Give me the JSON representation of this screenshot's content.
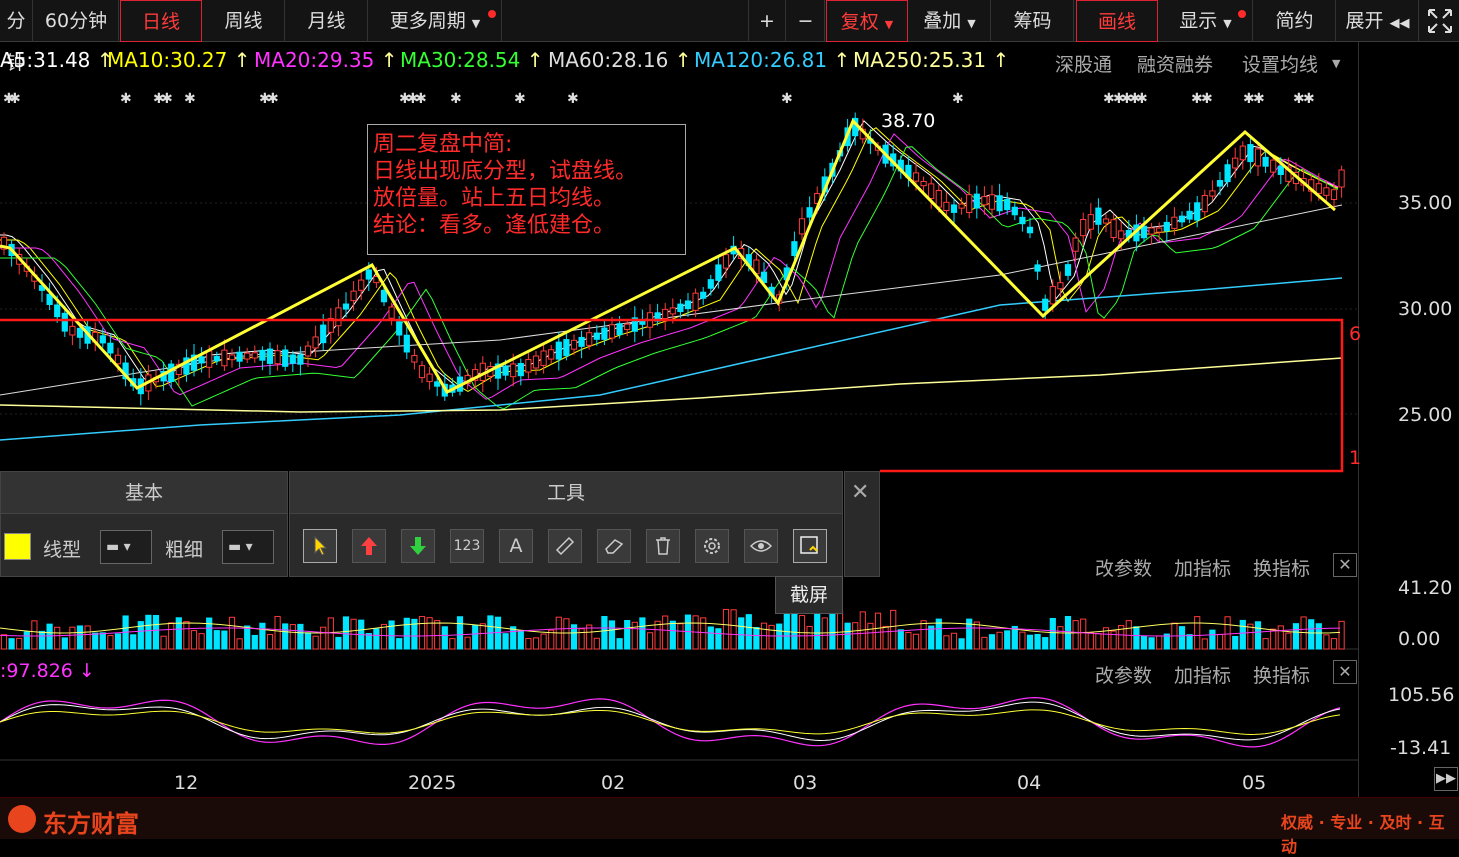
{
  "toolbar_left": [
    "分钟",
    "60分钟",
    "日线",
    "周线",
    "月线",
    "更多周期"
  ],
  "toolbar_right": {
    "plus": "+",
    "minus": "−",
    "fuquan": "复权",
    "diejia": "叠加",
    "chouma": "筹码",
    "huaxian": "画线",
    "xianshi": "显示",
    "jianyue": "简约",
    "zhankai": "展开"
  },
  "ma_legend": [
    {
      "label": "A5:31.48",
      "color": "#ffffff"
    },
    {
      "label": "MA10:30.27",
      "color": "#ffff00"
    },
    {
      "label": "MA20:29.35",
      "color": "#ff33ff"
    },
    {
      "label": "MA30:28.54",
      "color": "#33ff33"
    },
    {
      "label": "MA60:28.16",
      "color": "#dddddd"
    },
    {
      "label": "MA120:26.81",
      "color": "#33ccff"
    },
    {
      "label": "MA250:25.31",
      "color": "#ffff99"
    }
  ],
  "right_links": [
    "深股通",
    "融资融券",
    "设置均线"
  ],
  "price_axis": [
    "35.00",
    "30.00",
    "25.00"
  ],
  "peak_label": "38.70",
  "annotation": [
    "周二复盘中简:",
    "日线出现底分型，试盘线。",
    "放倍量。站上五日均线。",
    "结论：看多。逢低建仓。"
  ],
  "side_marks": [
    "6",
    "1"
  ],
  "panel_basic": {
    "title": "基本",
    "line_type_label": "线型",
    "thickness_label": "粗细"
  },
  "panel_tools": {
    "title": "工具",
    "numbers_tool": "123",
    "text_tool": "A"
  },
  "tooltip": "截屏",
  "volume_axis": [
    "41.20",
    "0.00"
  ],
  "indicator_links": [
    "改参数",
    "加指标",
    "换指标"
  ],
  "osc_value": ":97.826",
  "osc_axis": [
    "105.56",
    "-13.41"
  ],
  "x_axis": [
    "12",
    "2025",
    "02",
    "03",
    "04",
    "05"
  ],
  "brand": "东方财富",
  "slogan": "权威 · 专业 · 及时 · 互动",
  "icons": [
    "close-icon",
    "cursor-icon",
    "arrow-up-icon",
    "arrow-down-icon",
    "number-icon",
    "text-icon",
    "ruler-icon",
    "eraser-icon",
    "trash-icon",
    "gear-icon",
    "eye-icon",
    "screenshot-icon",
    "double-arrow-right-icon",
    "double-arrow-left-icon",
    "expand-icon"
  ]
}
